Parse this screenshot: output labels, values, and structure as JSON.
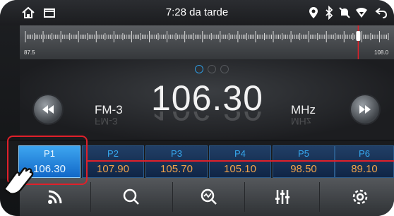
{
  "status_bar": {
    "time": "7:28 da tarde",
    "icons": [
      "home-icon",
      "window-icon",
      "location-icon",
      "bluetooth-icon",
      "mute-icon",
      "signal-icon",
      "back-icon"
    ]
  },
  "tuner": {
    "scale_min": "87.5",
    "scale_max": "108.0",
    "current_frequency_mhz": 106.3
  },
  "display": {
    "band": "FM-3",
    "frequency": "106.30",
    "unit": "MHz",
    "mode_icons": [
      "auto-mode-icon",
      "search-icon",
      "scan-icon"
    ],
    "active_mode": "auto-mode-icon"
  },
  "presets": [
    {
      "label": "P1",
      "frequency": "106.30",
      "active": true
    },
    {
      "label": "P2",
      "frequency": "107.90",
      "active": false
    },
    {
      "label": "P3",
      "frequency": "105.70",
      "active": false
    },
    {
      "label": "P4",
      "frequency": "105.10",
      "active": false
    },
    {
      "label": "P5",
      "frequency": "98.50",
      "active": false
    },
    {
      "label": "P6",
      "frequency": "89.10",
      "active": false
    }
  ],
  "bottom_bar": [
    "radio-stream-icon",
    "search-icon",
    "scan-icon",
    "equalizer-icon",
    "settings-icon"
  ],
  "colors": {
    "accent": "#2e9be0",
    "preset_frequency": "#f2a24a",
    "highlight": "#e0202a"
  }
}
